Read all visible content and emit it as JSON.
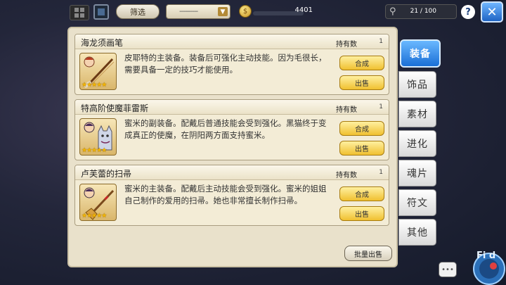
{
  "topbar": {
    "filter_label": "筛选",
    "dropdown_value": "----------",
    "dropdown_caret": "▼",
    "coin_symbol": "$",
    "coin_value": "4401",
    "capacity": "21 / 100",
    "help_label": "?",
    "close_label": "✕"
  },
  "items": [
    {
      "name": "海龙须画笔",
      "owned_label": "持有数",
      "owned_count": "1",
      "stars": "★★★★★",
      "desc": "皮耶特的主装备。装备后可强化主动技能。因为毛很长，需要具备一定的技巧才能使用。",
      "craft_label": "合成",
      "sell_label": "出售"
    },
    {
      "name": "特高阶使魔菲雷斯",
      "owned_label": "持有数",
      "owned_count": "1",
      "stars": "★★★★★",
      "desc": "蜜米的副装备。配戴后普通技能会受到强化。黑猫终于变成真正的使魔，在阴阳两方面支持蜜米。",
      "craft_label": "合成",
      "sell_label": "出售"
    },
    {
      "name": "卢芙蕾的扫帚",
      "owned_label": "持有数",
      "owned_count": "1",
      "stars": "★★★★★",
      "desc": "蜜米的主装备。配戴后主动技能会受到强化。蜜米的姐姐自己制作的爱用的扫帚。她也非常擅长制作扫帚。",
      "craft_label": "合成",
      "sell_label": "出售"
    }
  ],
  "bulk_sell_label": "批量出售",
  "tabs": [
    {
      "label": "装备",
      "active": true
    },
    {
      "label": "饰品",
      "active": false
    },
    {
      "label": "素材",
      "active": false
    },
    {
      "label": "进化",
      "active": false
    },
    {
      "label": "魂片",
      "active": false
    },
    {
      "label": "符文",
      "active": false
    },
    {
      "label": "其他",
      "active": false
    }
  ],
  "chat_glyph": "•••",
  "mascot_label": "Fi d",
  "colors": {
    "accent_blue": "#1a6fd6",
    "gold_button": "#f0c030",
    "panel_bg": "#e9e1cb"
  },
  "icons": {
    "coin": "gold-coin-icon",
    "capacity": "bag-capacity-icon"
  }
}
